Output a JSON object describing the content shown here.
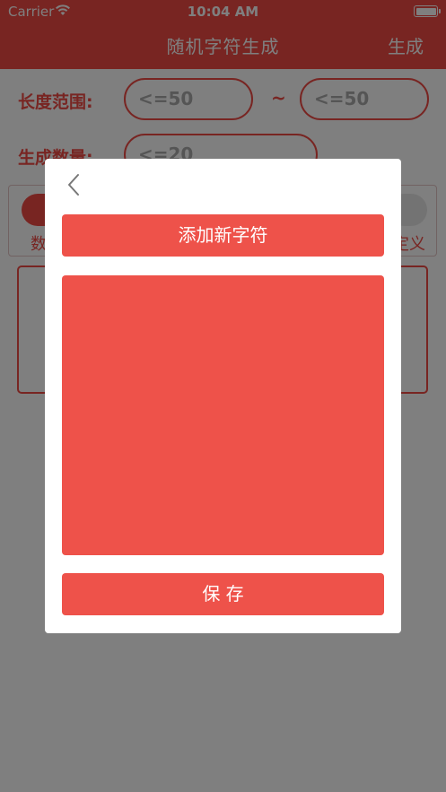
{
  "status_bar": {
    "carrier": "Carrier",
    "time": "10:04 AM"
  },
  "nav": {
    "title": "随机字符生成",
    "action": "生成"
  },
  "form": {
    "length_label": "长度范围:",
    "min_placeholder": "<=50",
    "range_separator": "~",
    "max_placeholder": "<=50",
    "count_label": "生成数量:",
    "count_placeholder": "<=20",
    "option_left_label": "数",
    "option_right_label": "定义"
  },
  "modal": {
    "add_button_label": "添加新字符",
    "characters_value": "",
    "save_button_label": "保 存"
  },
  "colors": {
    "accent": "#ee524a",
    "overlay": "rgba(0,0,0,0.5)"
  }
}
